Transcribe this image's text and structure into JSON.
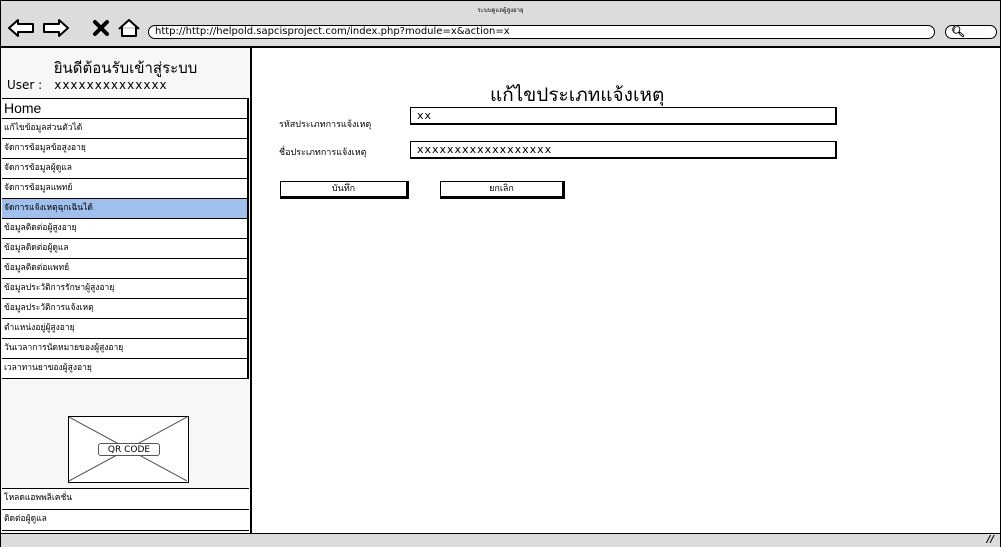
{
  "window": {
    "title": "ระบบดูแลผู้สูงอายุ"
  },
  "browser": {
    "url": "http://http://helpold.sapcisproject.com/index.php?module=x&action=x",
    "icons": [
      "back-arrow-icon",
      "forward-arrow-icon",
      "close-x-icon",
      "home-icon",
      "search-icon"
    ]
  },
  "sidebar": {
    "welcome": "ยินดีต้อนรับเข้าสู่ระบบ",
    "user_label": "User :",
    "user_value": "xxxxxxxxxxxxxx",
    "items": [
      {
        "label": "Home"
      },
      {
        "label": "แก้ไขข้อมูลส่วนตัวได้"
      },
      {
        "label": "จัดการข้อมูลข้อสูงอายุ"
      },
      {
        "label": "จัดการข้อมูลผู้ดูแล"
      },
      {
        "label": "จัดการข้อมูลแพทย์"
      },
      {
        "label": "จัดการแจ้งเหตุฉุกเฉินได้"
      },
      {
        "label": "ข้อมูลติดต่อผู้สูงอายุ"
      },
      {
        "label": "ข้อมูลติดต่อผู้ดูแล"
      },
      {
        "label": "ข้อมูลติดต่อแพทย์"
      },
      {
        "label": "ข้อมูลประวัติการรักษาผู้สูงอายุ"
      },
      {
        "label": "ข้อมูลประวัติการแจ้งเหตุ"
      },
      {
        "label": "ตำแหน่งอยู่ผู้สูงอายุ"
      },
      {
        "label": "วันเวลาการนัดหมายของผู้สูงอายุ"
      },
      {
        "label": "เวลาทานยาของผู้สูงอายุ"
      }
    ],
    "active_index": 5,
    "active_color": "#9fbfec",
    "qr_label": "QR CODE",
    "bottom_links": [
      {
        "label": "โหลดแอพพลิเคชั่น"
      },
      {
        "label": "ติดต่อผู้ดูแล"
      }
    ]
  },
  "main": {
    "title": "แก้ไขประเภทแจ้งเหตุ",
    "fields": [
      {
        "label": "รหัสประเภทการแจ้งเหตุ",
        "value": "xx"
      },
      {
        "label": "ชื่อประเภทการแจ้งเหตุ",
        "value": "xxxxxxxxxxxxxxxxxx"
      }
    ],
    "save_label": "บันทึก",
    "cancel_label": "ยกเลิก"
  }
}
